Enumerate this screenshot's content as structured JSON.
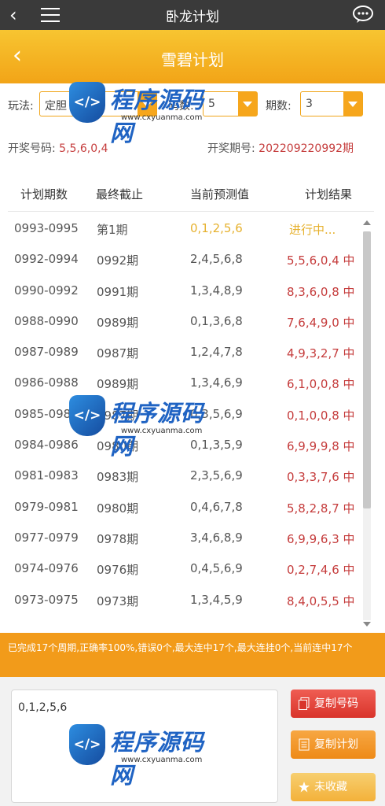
{
  "topbar": {
    "title": "卧龙计划"
  },
  "header": {
    "title": "雪碧计划"
  },
  "controls": {
    "play_label": "玩法:",
    "play_value": "定胆",
    "count_label": "码数:",
    "count_value": "5",
    "period_label": "期数:",
    "period_value": "3",
    "draw_label": "开奖号码:",
    "draw_value": "5,5,6,0,4",
    "issue_label": "开奖期号:",
    "issue_value": "202209220992期"
  },
  "table": {
    "headers": [
      "计划期数",
      "最终截止",
      "当前预测值",
      "计划结果"
    ],
    "rows": [
      [
        "0993-0995",
        "第1期",
        "0,1,2,5,6",
        "进行中..."
      ],
      [
        "0992-0994",
        "0992期",
        "2,4,5,6,8",
        "5,5,6,0,4 中"
      ],
      [
        "0990-0992",
        "0991期",
        "1,3,4,8,9",
        "8,3,6,0,8 中"
      ],
      [
        "0988-0990",
        "0989期",
        "0,1,3,6,8",
        "7,6,4,9,0 中"
      ],
      [
        "0987-0989",
        "0987期",
        "1,2,4,7,8",
        "4,9,3,2,7 中"
      ],
      [
        "0986-0988",
        "0989期",
        "1,3,4,6,9",
        "6,1,0,0,8 中"
      ],
      [
        "0985-0987",
        "0987期",
        "0,3,5,6,9",
        "0,1,0,0,8 中"
      ],
      [
        "0984-0986",
        "0980期",
        "0,1,3,5,9",
        "6,9,9,9,8 中"
      ],
      [
        "0981-0983",
        "0983期",
        "2,3,5,6,9",
        "0,3,3,7,6 中"
      ],
      [
        "0979-0981",
        "0980期",
        "0,4,6,7,8",
        "5,8,2,8,7 中"
      ],
      [
        "0977-0979",
        "0978期",
        "3,4,6,8,9",
        "6,9,9,6,3 中"
      ],
      [
        "0974-0976",
        "0976期",
        "0,4,5,6,9",
        "0,2,7,4,6 中"
      ],
      [
        "0973-0975",
        "0973期",
        "1,3,4,5,9",
        "8,4,0,5,5 中"
      ]
    ]
  },
  "summary": "已完成17个周期,正确率100%,错误0个,最大连中17个,最大连挂0个,当前连中17个",
  "bottom": {
    "textarea_value": "0,1,2,5,6",
    "copy_numbers": "复制号码",
    "copy_plan": "复制计划",
    "favorite": "未收藏"
  },
  "watermark": {
    "brand": "程序源码网",
    "url": "www.cxyuanma.com"
  },
  "colors": {
    "accent": "#f2a417",
    "result_red": "#c53c3c",
    "pending_gold": "#e6b12e"
  }
}
